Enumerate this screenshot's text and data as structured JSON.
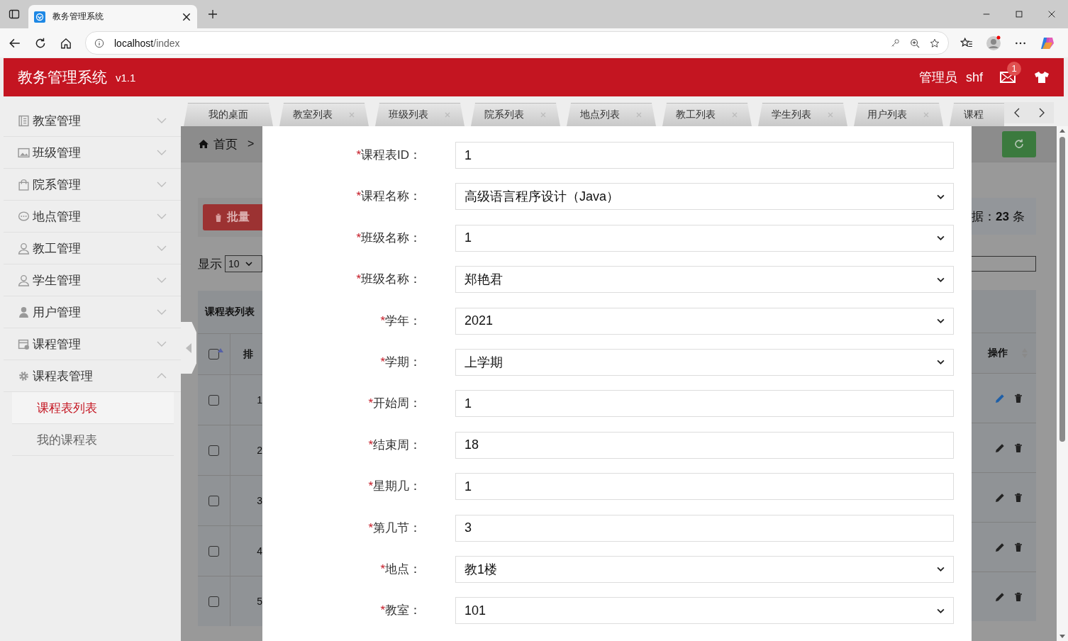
{
  "browser": {
    "tab_title": "教务管理系统",
    "url_host": "localhost",
    "url_path": "/index"
  },
  "app": {
    "title": "教务管理系统",
    "version": "v1.1",
    "role": "管理员",
    "user": "shf",
    "mail_badge": "1"
  },
  "sidebar": [
    {
      "label": "教室管理",
      "kind": "book",
      "expanded": false
    },
    {
      "label": "班级管理",
      "kind": "image",
      "expanded": false
    },
    {
      "label": "院系管理",
      "kind": "bag",
      "expanded": false
    },
    {
      "label": "地点管理",
      "kind": "chat",
      "expanded": false
    },
    {
      "label": "教工管理",
      "kind": "person",
      "expanded": false
    },
    {
      "label": "学生管理",
      "kind": "person",
      "expanded": false
    },
    {
      "label": "用户管理",
      "kind": "user",
      "expanded": false
    },
    {
      "label": "课程管理",
      "kind": "calendar",
      "expanded": false
    },
    {
      "label": "课程表管理",
      "kind": "gear",
      "expanded": true,
      "children": [
        {
          "label": "课程表列表",
          "selected": true
        },
        {
          "label": "我的课程表",
          "selected": false
        }
      ]
    }
  ],
  "tabs": [
    {
      "label": "我的桌面",
      "closable": false
    },
    {
      "label": "教室列表",
      "closable": true
    },
    {
      "label": "班级列表",
      "closable": true
    },
    {
      "label": "院系列表",
      "closable": true
    },
    {
      "label": "地点列表",
      "closable": true
    },
    {
      "label": "教工列表",
      "closable": true
    },
    {
      "label": "学生列表",
      "closable": true
    },
    {
      "label": "用户列表",
      "closable": true
    },
    {
      "label": "课程",
      "closable": false
    }
  ],
  "background": {
    "breadcrumb": "首页",
    "breadcrumb_sep": ">",
    "batch_button": "批量",
    "show_label": "显示",
    "page_size": "10",
    "panel_title": "课程表列表",
    "id_header": "排",
    "select_all_checked": false,
    "count_prefix": "据：",
    "count": "23",
    "count_suffix": "条",
    "actions_header": "操作",
    "rows": [
      {
        "number": "1",
        "checked": false,
        "edit_active": true
      },
      {
        "number": "2",
        "checked": false,
        "edit_active": false
      },
      {
        "number": "3",
        "checked": false,
        "edit_active": false
      },
      {
        "number": "4",
        "checked": false,
        "edit_active": false
      },
      {
        "number": "5",
        "checked": false,
        "edit_active": false
      }
    ]
  },
  "form": [
    {
      "mark": "*",
      "label": "课程表ID：",
      "kind": "input",
      "value": "1"
    },
    {
      "mark": "*",
      "label": "课程名称：",
      "kind": "select",
      "value": "高级语言程序设计（Java）"
    },
    {
      "mark": "*",
      "label": "班级名称：",
      "kind": "select",
      "value": "1"
    },
    {
      "mark": "*",
      "label": "班级名称：",
      "kind": "select",
      "value": "郑艳君"
    },
    {
      "mark": "*",
      "label": "学年：",
      "kind": "select",
      "value": "2021"
    },
    {
      "mark": "*",
      "label": "学期：",
      "kind": "select",
      "value": "上学期"
    },
    {
      "mark": "*",
      "label": "开始周：",
      "kind": "input",
      "value": "1"
    },
    {
      "mark": "*",
      "label": "结束周：",
      "kind": "input",
      "value": "18"
    },
    {
      "mark": "*",
      "label": "星期几：",
      "kind": "input",
      "value": "1"
    },
    {
      "mark": "*",
      "label": "第几节：",
      "kind": "input",
      "value": "3"
    },
    {
      "mark": "*",
      "label": "地点：",
      "kind": "select",
      "value": "教1楼"
    },
    {
      "mark": "*",
      "label": "教室：",
      "kind": "select",
      "value": "101"
    }
  ]
}
